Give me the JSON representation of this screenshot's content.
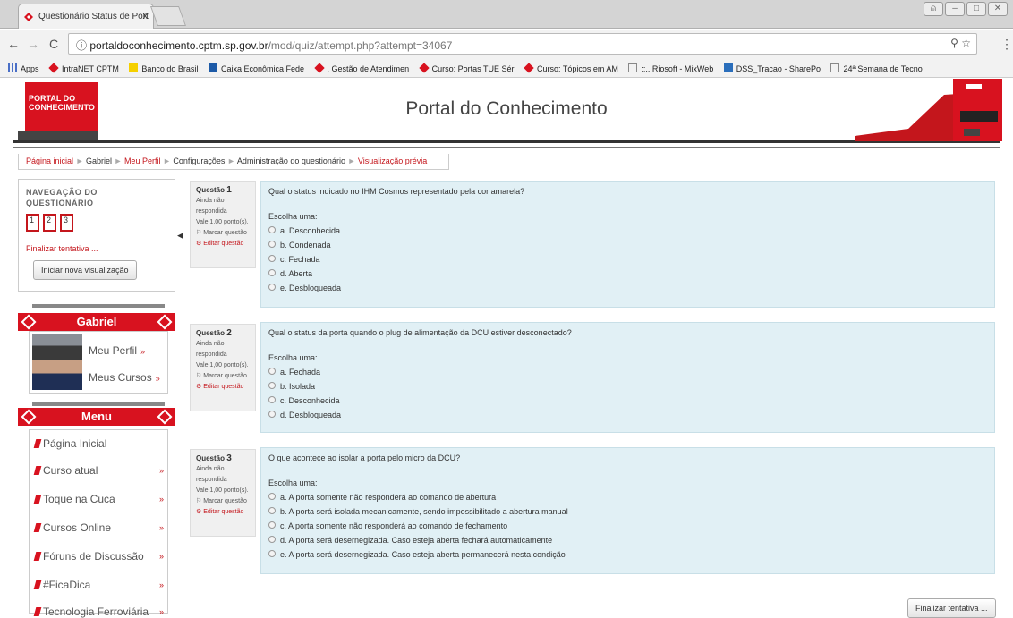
{
  "browser": {
    "tab_title": "Questionário Status de Port",
    "tab_close": "x",
    "url_host": "portaldoconhecimento.cptm.sp.gov.br",
    "url_path": "/mod/quiz/attempt.php?attempt=34067",
    "bookmarks": [
      "Apps",
      "IntraNET CPTM",
      "Banco do Brasil",
      "Caixa Econômica Fede",
      ". Gestão de Atendimen",
      "Curso: Portas TUE Sér",
      "Curso: Tópicos em AM",
      "::.. Riosoft - MixWeb",
      "DSS_Tracao - SharePo",
      "24ª Semana de Tecno"
    ]
  },
  "site": {
    "title": "Portal do Conhecimento",
    "logo_line1": "PORTAL DO",
    "logo_line2": "CONHECIMENTO"
  },
  "breadcrumb": {
    "home": "Página inicial",
    "user": "Gabriel",
    "profile": "Meu Perfil",
    "config": "Configurações",
    "admin": "Administração do questionário",
    "current": "Visualização prévia"
  },
  "quiz_nav": {
    "title": "NAVEGAÇÃO DO QUESTIONÁRIO",
    "questions": [
      "1",
      "2",
      "3"
    ],
    "finish_link": "Finalizar tentativa ...",
    "new_preview": "Iniciar nova visualização"
  },
  "user_block": {
    "name": "Gabriel",
    "links": [
      "Meu Perfil",
      "Meus Cursos"
    ]
  },
  "menu_block": {
    "title": "Menu",
    "items": [
      "Página Inicial",
      "Curso atual",
      "Toque na Cuca",
      "Cursos Online",
      "Fóruns de Discussão",
      "#FicaDica",
      "Tecnologia Ferroviária"
    ]
  },
  "questions": [
    {
      "label": "Questão",
      "number": "1",
      "status": "Ainda não respondida",
      "value": "Vale 1,00 ponto(s).",
      "flag": "Marcar questão",
      "edit": "Editar questão",
      "text": "Qual o status indicado no IHM Cosmos representado pela cor amarela?",
      "prompt": "Escolha uma:",
      "options": [
        "a. Desconhecida",
        "b. Condenada",
        "c. Fechada",
        "d. Aberta",
        "e. Desbloqueada"
      ]
    },
    {
      "label": "Questão",
      "number": "2",
      "status": "Ainda não respondida",
      "value": "Vale 1,00 ponto(s).",
      "flag": "Marcar questão",
      "edit": "Editar questão",
      "text": "Qual o status da porta quando o plug de alimentação da DCU estiver desconectado?",
      "prompt": "Escolha uma:",
      "options": [
        "a. Fechada",
        "b. Isolada",
        "c. Desconhecida",
        "d. Desbloqueada"
      ]
    },
    {
      "label": "Questão",
      "number": "3",
      "status": "Ainda não respondida",
      "value": "Vale 1,00 ponto(s).",
      "flag": "Marcar questão",
      "edit": "Editar questão",
      "text": "O que acontece ao isolar a porta pelo micro da DCU?",
      "prompt": "Escolha uma:",
      "options": [
        "a. A porta somente não responderá ao comando de abertura",
        "b. A porta será isolada mecanicamente, sendo impossibilitado a abertura manual",
        "c. A porta somente não responderá ao comando de fechamento",
        "d. A porta será desernegizada. Caso esteja aberta fechará automaticamente",
        "e. A porta será desernegizada. Caso esteja aberta permanecerá nesta condição"
      ]
    }
  ],
  "finish_button": "Finalizar tentativa ...",
  "colors": {
    "brand_red": "#d8121f",
    "question_bg": "#e1f0f5"
  }
}
